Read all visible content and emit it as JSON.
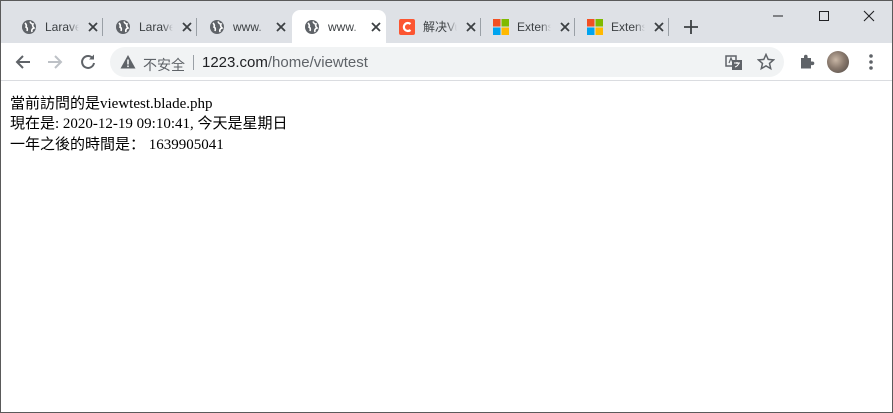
{
  "tabs": [
    {
      "title": "Laravel",
      "icon": "globe-icon",
      "active": false
    },
    {
      "title": "Laravel",
      "icon": "globe-icon",
      "active": false
    },
    {
      "title": "www.",
      "icon": "globe-icon",
      "active": false
    },
    {
      "title": "www.",
      "icon": "globe-icon",
      "active": true
    },
    {
      "title": "解决Vue",
      "icon": "csdn-icon",
      "active": false
    },
    {
      "title": "Extensions",
      "icon": "microsoft-icon",
      "active": false
    },
    {
      "title": "Extensions",
      "icon": "microsoft-icon",
      "active": false
    }
  ],
  "omnibox": {
    "security_label": "不安全",
    "url_host": "1223.com",
    "url_path": "/home/viewtest"
  },
  "page": {
    "line1": "當前訪問的是viewtest.blade.php",
    "line2": "現在是: 2020-12-19 09:10:41, 今天是星期日",
    "line3": "一年之後的時間是： 1639905041"
  },
  "colors": {
    "tabstrip_bg": "#dee1e6",
    "omnibox_bg": "#f1f3f4",
    "csdn_red": "#fc5531"
  }
}
